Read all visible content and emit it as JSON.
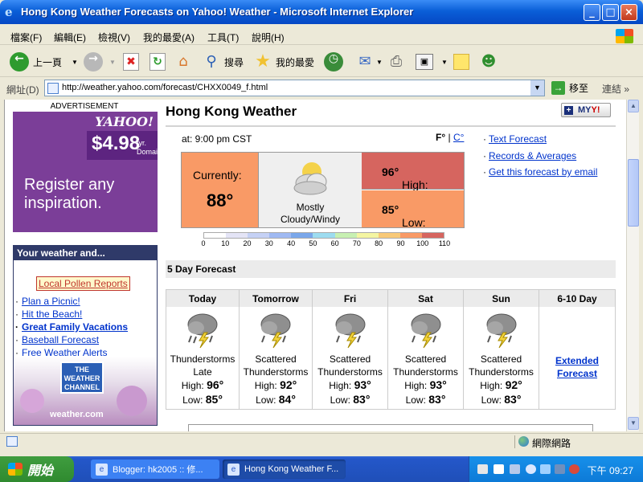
{
  "window": {
    "title": "Hong Kong Weather Forecasts on Yahoo! Weather - Microsoft Internet Explorer",
    "buttons": [
      "_",
      "□",
      "×"
    ]
  },
  "menu": [
    "檔案(F)",
    "編輯(E)",
    "檢視(V)",
    "我的最愛(A)",
    "工具(T)",
    "說明(H)"
  ],
  "toolbar": {
    "back_label": "上一頁",
    "search_label": "搜尋",
    "favorites_label": "我的最愛"
  },
  "address": {
    "label": "網址(D)",
    "url": "http://weather.yahoo.com/forecast/CHXX0049_f.html",
    "go_label": "移至",
    "links_label": "連結"
  },
  "ad": {
    "label": "ADVERTISEMENT",
    "brand": "YAHOO!",
    "price": "$4.98",
    "per": "/yr.",
    "domains": "Domains",
    "headline": "Register any inspiration."
  },
  "sidebar": {
    "header": "Your weather and...",
    "pollen": "Local Pollen Reports",
    "links": [
      {
        "label": "Plan a Picnic!",
        "bold": false
      },
      {
        "label": "Hit the Beach!",
        "bold": false
      },
      {
        "label": "Great Family Vacations",
        "bold": true
      },
      {
        "label": "Baseball Forecast",
        "bold": false
      },
      {
        "label": "Free Weather Alerts",
        "bold": false
      }
    ],
    "twc_logo": "THE WEATHER CHANNEL",
    "twc_url": "weather.com"
  },
  "page": {
    "title": "Hong Kong Weather",
    "myyahoo": "MY",
    "myyahoo_y": "Y!",
    "obs_time": "at: 9:00 pm CST",
    "unit_f": "F°",
    "unit_sep": "|",
    "unit_c": "C°"
  },
  "current": {
    "label": "Currently:",
    "temp": "88°",
    "condition_line1": "Mostly",
    "condition_line2": "Cloudy/Windy",
    "high_label": "High:",
    "high": "96°",
    "low_label": "Low:",
    "low": "85°"
  },
  "scale": {
    "ticks": [
      "0",
      "10",
      "20",
      "30",
      "40",
      "50",
      "60",
      "70",
      "80",
      "90",
      "100",
      "110"
    ],
    "colors": [
      "#ffffff",
      "#e4e4f6",
      "#c5d1f5",
      "#9fb9f2",
      "#7aa7ea",
      "#9ddcf0",
      "#c7f0b2",
      "#f4f5a2",
      "#f8c978",
      "#f99a66",
      "#d6655f"
    ]
  },
  "side_links": [
    "Text Forecast",
    "Records & Averages",
    "Get this forecast by email"
  ],
  "forecast": {
    "header": "5 Day Forecast",
    "days": [
      {
        "day": "Today",
        "cond1": "Thunderstorms",
        "cond2": "Late",
        "high_label": "High:",
        "high": "96°",
        "low_label": "Low:",
        "low": "85°"
      },
      {
        "day": "Tomorrow",
        "cond1": "Scattered",
        "cond2": "Thunderstorms",
        "high_label": "High:",
        "high": "92°",
        "low_label": "Low:",
        "low": "84°"
      },
      {
        "day": "Fri",
        "cond1": "Scattered",
        "cond2": "Thunderstorms",
        "high_label": "High:",
        "high": "93°",
        "low_label": "Low:",
        "low": "83°"
      },
      {
        "day": "Sat",
        "cond1": "Scattered",
        "cond2": "Thunderstorms",
        "high_label": "High:",
        "high": "93°",
        "low_label": "Low:",
        "low": "83°"
      },
      {
        "day": "Sun",
        "cond1": "Scattered",
        "cond2": "Thunderstorms",
        "high_label": "High:",
        "high": "92°",
        "low_label": "Low:",
        "low": "83°"
      }
    ],
    "extended": {
      "day": "6-10 Day",
      "link1": "Extended",
      "link2": "Forecast"
    }
  },
  "status": {
    "zone": "網際網路"
  },
  "taskbar": {
    "start": "開始",
    "tasks": [
      "Blogger: hk2005 :: 修...",
      "Hong Kong Weather F..."
    ],
    "clock": "下午 09:27"
  }
}
